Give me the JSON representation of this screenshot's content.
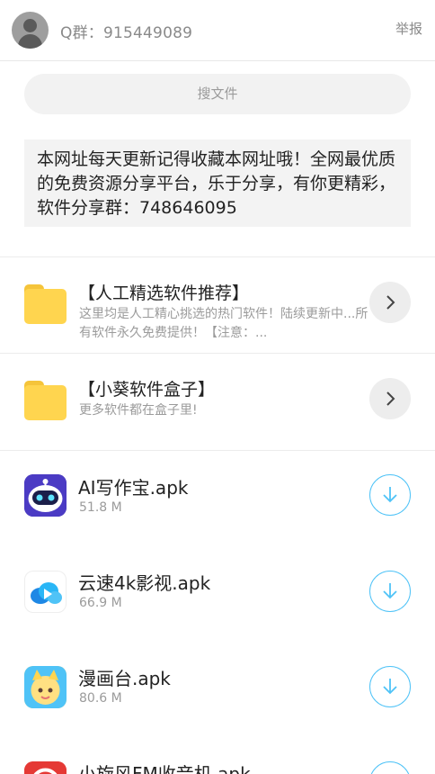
{
  "header": {
    "group_label": "Q群：915449089",
    "report_label": "举报"
  },
  "search": {
    "placeholder": "搜文件"
  },
  "notice": {
    "text": "本网址每天更新记得收藏本网址哦！全网最优质的免费资源分享平台，乐于分享，有你更精彩，软件分享群：748646095"
  },
  "folders": [
    {
      "title": "【人工精选软件推荐】",
      "description": "这里均是人工精心挑选的热门软件！陆续更新中...所有软件永久免费提供！【注意：..."
    },
    {
      "title": "【小葵软件盒子】",
      "description": "更多软件都在盒子里!"
    }
  ],
  "files": [
    {
      "name": "AI写作宝.apk",
      "size": "51.8 M",
      "icon": "robot-app-icon"
    },
    {
      "name": "云速4k影视.apk",
      "size": "66.9 M",
      "icon": "cloud-video-app-icon"
    },
    {
      "name": "漫画台.apk",
      "size": "80.6 M",
      "icon": "manga-app-icon"
    },
    {
      "name": "小旋风FM收音机.apk",
      "size": "",
      "icon": "radio-app-icon"
    }
  ],
  "colors": {
    "accent": "#4fc3f7",
    "folder": "#ffd54f",
    "muted_text": "#9b9b9b"
  }
}
